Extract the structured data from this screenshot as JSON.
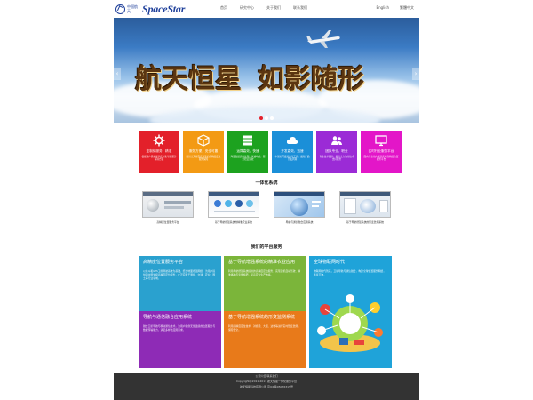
{
  "header": {
    "logo_cn": "中国航天",
    "logo_en": "SpaceStar",
    "nav": [
      "首页",
      "研究中心",
      "关于我们",
      "联系我们"
    ],
    "lang": [
      "English",
      "繁體中文"
    ]
  },
  "banner": {
    "slogan_1": "航天恒星",
    "slogan_2": "如影随形",
    "prev_label": "‹",
    "next_label": "›"
  },
  "features": [
    {
      "title": "定制化服务，精准",
      "desc": "根据客户需求提供定制化导航服务解决方案",
      "color": "#e3202a",
      "icon": "gear-icon"
    },
    {
      "title": "服务方便，安全可靠",
      "desc": "提供全天候稳定可靠的高精度定位服务保障",
      "color": "#f39a14",
      "icon": "box-icon"
    },
    {
      "title": "运算高效，快速",
      "desc": "海量数据实时处理，快速响应，服务稳定高效",
      "color": "#1da21f",
      "icon": "server-icon"
    },
    {
      "title": "开发高效，迅速",
      "desc": "丰富的开发接口与工具，缩短产品开发周期",
      "color": "#1b8fd8",
      "icon": "cloud-icon"
    },
    {
      "title": "团队专业，职业",
      "desc": "专业技术团队，提供全方位的技术支持服务",
      "color": "#9b2bd6",
      "icon": "team-icon"
    },
    {
      "title": "实时行业服务平台",
      "desc": "面向行业用户提供实时高精度位置服务平台",
      "color": "#e316c8",
      "icon": "screen-icon"
    }
  ],
  "system": {
    "title": "一体化系统",
    "items": [
      "高精度位置服务平台",
      "基于导航增强系统的精准农业系统",
      "导航与通信融合应用系统",
      "基于导航增强系统的形变监测系统"
    ]
  },
  "services": {
    "title": "我们的平台服务",
    "tiles": [
      {
        "title": "高精度位置服务平台",
        "desc": "以北斗和GPS卫星导航系统为基础，结合地面增强网络，为用户提供实时厘米级高精度定位服务，广泛应用于测绘、交通、农业、国土等行业领域。",
        "color": "#2aa1cf"
      },
      {
        "title": "基于导航增强系统的精准农业应用",
        "desc": "利用导航增强系统提供的高精度定位服务，实现农机自动驾驶、精准播种与变量施肥，提高农业生产效率。",
        "color": "#7bb53a"
      },
      {
        "title": "全球物联网时代",
        "desc": "物联网时代到来，卫星导航与通信融合，构建全球位置服务网络，连接万物。",
        "color": "#1fa3d9"
      },
      {
        "title": "导航与通信融合应用系统",
        "desc": "融合卫星导航与移动通信技术，为用户提供无缝连续的位置服务与数据传输能力，满足多样化应用需求。",
        "color": "#8e2bb6"
      },
      {
        "title": "基于导航增强系统的形变监测系统",
        "desc": "利用高精度定位技术，对桥梁、大坝、边坡等进行实时形变监测，保障安全。",
        "color": "#e87a1a"
      }
    ]
  },
  "footer": {
    "links": "公司介绍  联系我们",
    "copyright": "Copyright@2011-2017 航天恒星一体化服务平台",
    "icp": "航天恒星科技有限公司 京ICP备05076315号"
  }
}
